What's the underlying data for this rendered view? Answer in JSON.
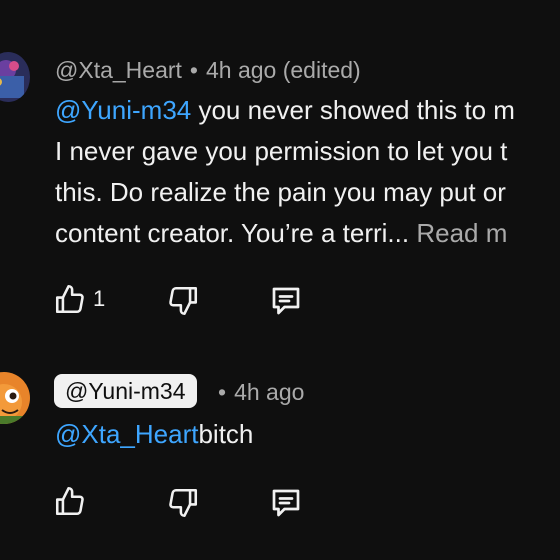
{
  "comments": [
    {
      "handle": "@Xta_Heart",
      "separator": "•",
      "time": "4h ago",
      "edited": "(edited)",
      "line1_mention": "@Yuni-m34",
      "line1_text": " you never showed this to m",
      "line2": "I never gave you permission to let you t",
      "line3": "this. Do realize the pain you may put or",
      "line4": "content creator. You’re a terri...",
      "read_more": "Read m",
      "like_count": "1"
    },
    {
      "handle": "@Yuni-m34",
      "separator": "•",
      "time": "4h ago",
      "mention": "@Xta_Heart",
      "text": "bitch"
    }
  ],
  "icons": {
    "like": "thumb-up-icon",
    "dislike": "thumb-down-icon",
    "reply": "reply-icon"
  },
  "colors": {
    "background": "#0f0f0f",
    "text": "#f1f1f1",
    "meta": "#aaaaaa",
    "mention": "#3ea6ff",
    "chip": "#f1f1f1"
  }
}
